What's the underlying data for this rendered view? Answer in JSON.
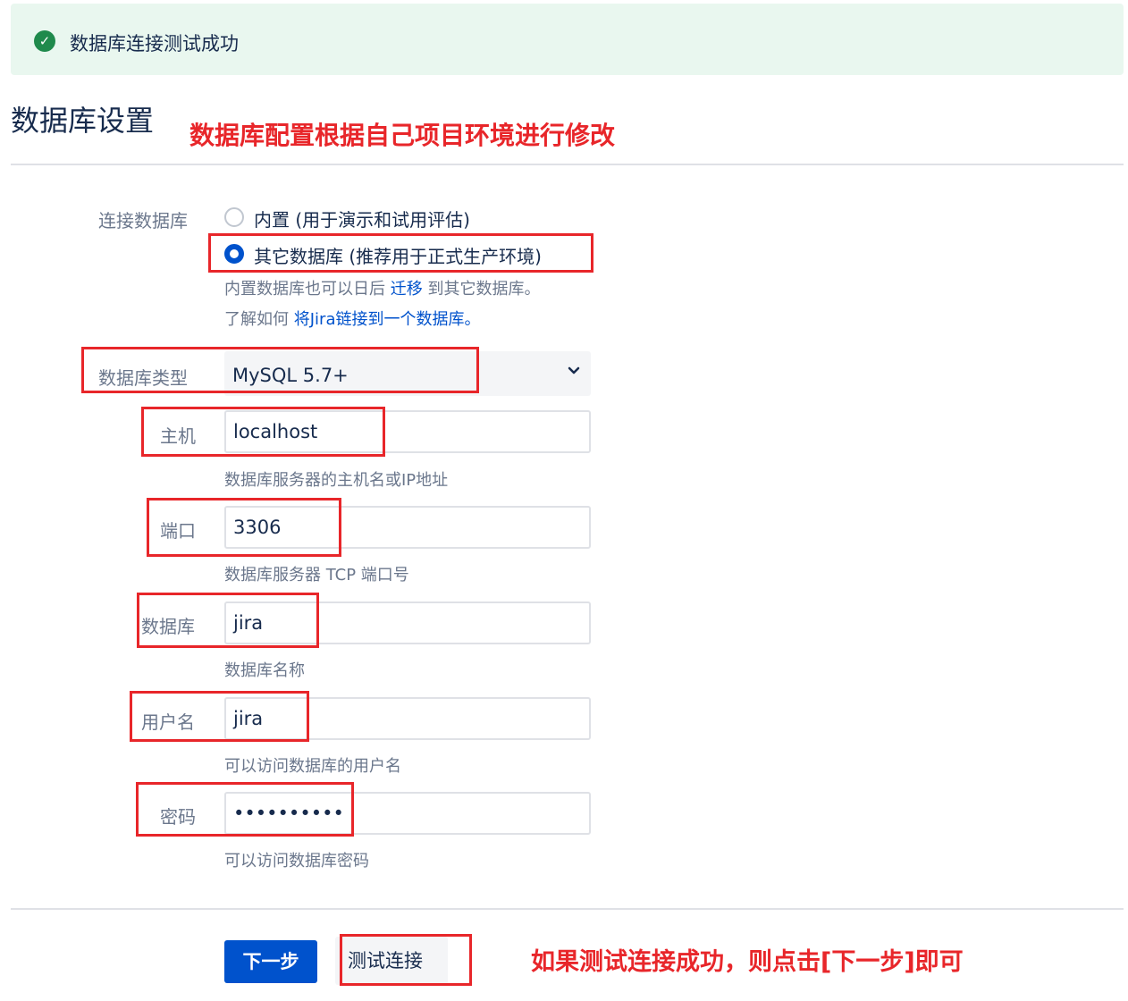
{
  "banner": {
    "message": "数据库连接测试成功",
    "status_color": "#1f8a4c"
  },
  "page": {
    "title": "数据库设置"
  },
  "annotations": {
    "top": "数据库配置根据自己项目环境进行修改",
    "bottom": "如果测试连接成功，则点击[下一步]即可",
    "color": "#e8262a"
  },
  "connection": {
    "label": "连接数据库",
    "options": [
      {
        "label": "内置 (用于演示和试用评估)",
        "selected": false
      },
      {
        "label": "其它数据库 (推荐用于正式生产环境)",
        "selected": true
      }
    ],
    "hint1_pre": "内置数据库也可以日后",
    "hint1_link": "迁移",
    "hint1_post": "到其它数据库。",
    "hint2_pre": "了解如何",
    "hint2_link": "将Jira链接到一个数据库。"
  },
  "db_type": {
    "label": "数据库类型",
    "value": "MySQL 5.7+"
  },
  "fields": {
    "host": {
      "label": "主机",
      "value": "localhost",
      "hint": "数据库服务器的主机名或IP地址"
    },
    "port": {
      "label": "端口",
      "value": "3306",
      "hint": "数据库服务器 TCP 端口号"
    },
    "database": {
      "label": "数据库",
      "value": "jira",
      "hint": "数据库名称"
    },
    "username": {
      "label": "用户名",
      "value": "jira",
      "hint": "可以访问数据库的用户名"
    },
    "password": {
      "label": "密码",
      "value": "••••••••••",
      "hint": "可以访问数据库密码"
    }
  },
  "buttons": {
    "next": "下一步",
    "test": "测试连接"
  },
  "colors": {
    "primary": "#0052cc",
    "link": "#0052cc"
  }
}
